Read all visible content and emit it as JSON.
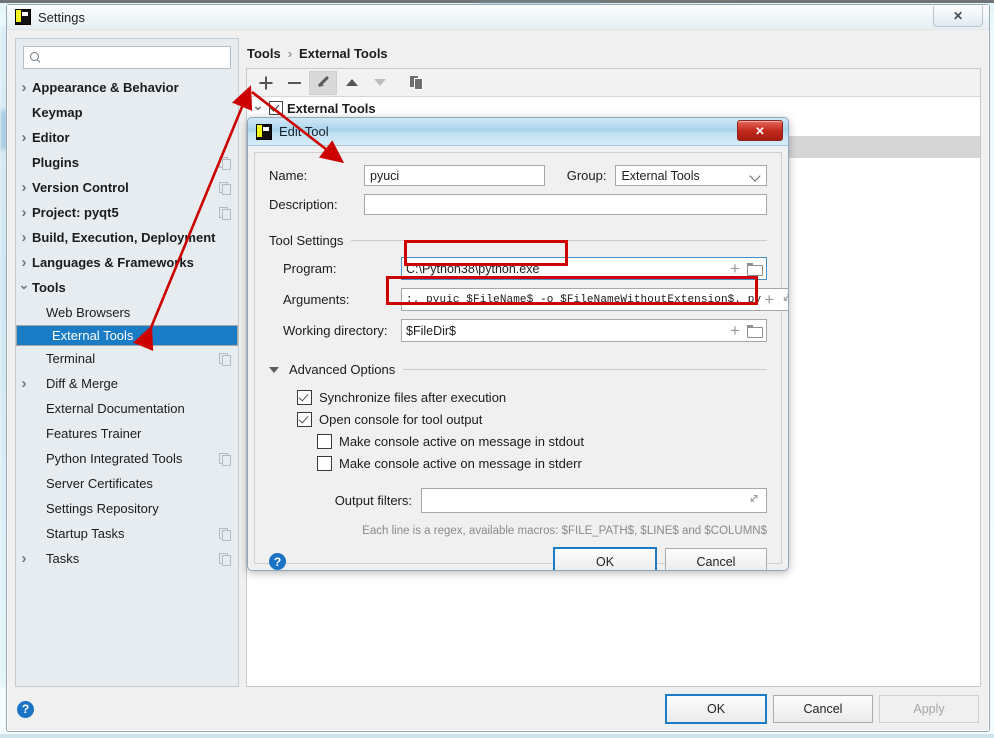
{
  "window": {
    "title": "Settings",
    "icon": "pycharm-icon",
    "close_label": "✕"
  },
  "search": {
    "value": "",
    "placeholder": "",
    "icon": "search-icon"
  },
  "sidebar": {
    "items": [
      {
        "label": "Appearance & Behavior",
        "arrow": "right",
        "bold": true,
        "selected": false,
        "copy": false
      },
      {
        "label": "Keymap",
        "arrow": "none",
        "bold": true,
        "selected": false,
        "copy": false
      },
      {
        "label": "Editor",
        "arrow": "right",
        "bold": true,
        "selected": false,
        "copy": false
      },
      {
        "label": "Plugins",
        "arrow": "none",
        "bold": true,
        "selected": false,
        "copy": true
      },
      {
        "label": "Version Control",
        "arrow": "right",
        "bold": true,
        "selected": false,
        "copy": true
      },
      {
        "label": "Project: pyqt5",
        "arrow": "right",
        "bold": true,
        "selected": false,
        "copy": true
      },
      {
        "label": "Build, Execution, Deployment",
        "arrow": "right",
        "bold": true,
        "selected": false,
        "copy": false
      },
      {
        "label": "Languages & Frameworks",
        "arrow": "right",
        "bold": true,
        "selected": false,
        "copy": false
      },
      {
        "label": "Tools",
        "arrow": "down",
        "bold": true,
        "selected": false,
        "copy": false
      },
      {
        "label": "Web Browsers",
        "arrow": "none",
        "bold": false,
        "selected": false,
        "copy": false,
        "indent": true
      },
      {
        "label": "External Tools",
        "arrow": "none",
        "bold": false,
        "selected": true,
        "copy": false,
        "indent": true
      },
      {
        "label": "Terminal",
        "arrow": "none",
        "bold": false,
        "selected": false,
        "copy": true,
        "indent": true
      },
      {
        "label": "Diff & Merge",
        "arrow": "right",
        "bold": false,
        "selected": false,
        "copy": false,
        "indent": true
      },
      {
        "label": "External Documentation",
        "arrow": "none",
        "bold": false,
        "selected": false,
        "copy": false,
        "indent": true
      },
      {
        "label": "Features Trainer",
        "arrow": "none",
        "bold": false,
        "selected": false,
        "copy": false,
        "indent": true
      },
      {
        "label": "Python Integrated Tools",
        "arrow": "none",
        "bold": false,
        "selected": false,
        "copy": true,
        "indent": true
      },
      {
        "label": "Server Certificates",
        "arrow": "none",
        "bold": false,
        "selected": false,
        "copy": false,
        "indent": true
      },
      {
        "label": "Settings Repository",
        "arrow": "none",
        "bold": false,
        "selected": false,
        "copy": false,
        "indent": true
      },
      {
        "label": "Startup Tasks",
        "arrow": "none",
        "bold": false,
        "selected": false,
        "copy": true,
        "indent": true
      },
      {
        "label": "Tasks",
        "arrow": "right",
        "bold": false,
        "selected": false,
        "copy": true,
        "indent": true
      }
    ]
  },
  "breadcrumb": {
    "parent": "Tools",
    "separator": "›",
    "current": "External Tools"
  },
  "toolbar": {
    "add": "add-icon",
    "remove": "remove-icon",
    "edit": "pencil-icon",
    "move_up": "arrow-up-icon",
    "move_down": "arrow-down-icon",
    "duplicate": "copy-icon"
  },
  "tools_tree": {
    "root_label": "External Tools",
    "root_checked": true
  },
  "footer": {
    "help": "?",
    "ok": "OK",
    "cancel": "Cancel",
    "apply": "Apply"
  },
  "dialog": {
    "title": "Edit Tool",
    "icon": "pycharm-icon",
    "close_label": "✕",
    "name_label": "Name:",
    "name_value": "pyuci",
    "group_label": "Group:",
    "group_value": "External Tools",
    "description_label": "Description:",
    "description_value": "",
    "tool_settings_label": "Tool Settings",
    "program_label": "Program:",
    "program_value": "C:\\Python38\\python.exe",
    "arguments_label": "Arguments:",
    "arguments_value": ":. pyuic  $FileName$ -o $FileNameWithoutExtension$. py",
    "working_dir_label": "Working directory:",
    "working_dir_value": "$FileDir$",
    "advanced_options_label": "Advanced Options",
    "checkboxes": [
      {
        "label": "Synchronize files after execution",
        "checked": true,
        "indent": false
      },
      {
        "label": "Open console for tool output",
        "checked": true,
        "indent": false
      },
      {
        "label": "Make console active on message in stdout",
        "checked": false,
        "indent": true
      },
      {
        "label": "Make console active on message in stderr",
        "checked": false,
        "indent": true
      }
    ],
    "output_filters_label": "Output filters:",
    "output_filters_value": "",
    "hint": "Each line is a regex, available macros: $FILE_PATH$, $LINE$ and $COLUMN$",
    "help": "?",
    "ok": "OK",
    "cancel": "Cancel"
  },
  "annotations": {
    "accent_color": "#cc0000",
    "highlight_program": "program-field-highlight",
    "highlight_arguments": "arguments-field-highlight",
    "arrow_to_add_button": "arrow-sidebar-to-add-button",
    "arrow_to_name_field": "arrow-to-name-field"
  },
  "colors": {
    "selection_blue": "#1a7cc4",
    "dialog_title_blue": "#a9d4ec",
    "close_red": "#c22a1d"
  }
}
